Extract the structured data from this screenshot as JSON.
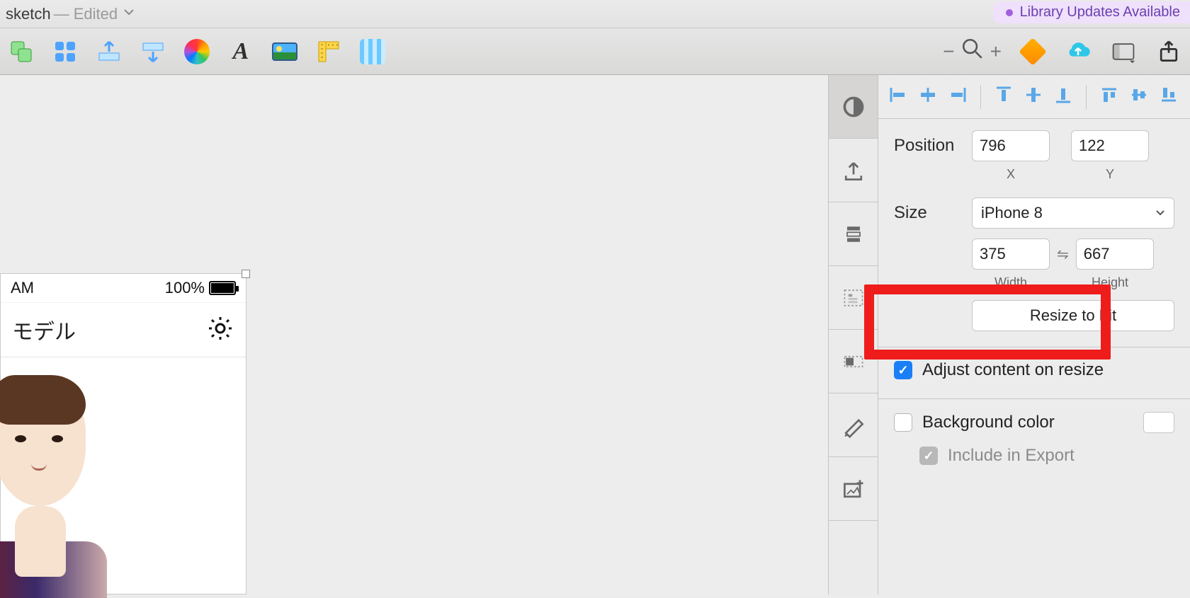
{
  "titlebar": {
    "doc": "sketch",
    "edited": "— Edited",
    "library_notice": "Library Updates Available"
  },
  "artboard": {
    "status_time": "AM",
    "battery_pct": "100%",
    "header_title": "モデル"
  },
  "inspector": {
    "position_label": "Position",
    "x": "796",
    "y": "122",
    "x_label": "X",
    "y_label": "Y",
    "size_label": "Size",
    "preset": "iPhone 8",
    "width": "375",
    "height": "667",
    "width_label": "Width",
    "height_label": "Height",
    "resize_btn": "Resize to Fit",
    "adjust_label": "Adjust content on resize",
    "bg_label": "Background color",
    "include_label": "Include in Export"
  },
  "zoom": {
    "minus": "−",
    "plus": "+"
  }
}
